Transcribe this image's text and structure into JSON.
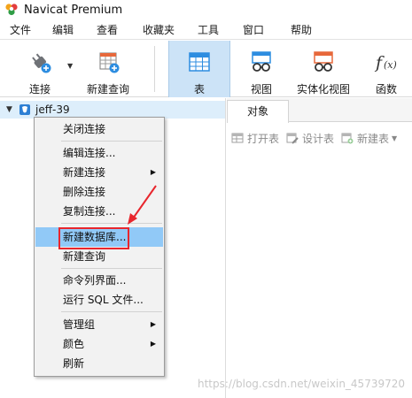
{
  "window": {
    "title": "Navicat Premium",
    "logo_icon": "navicat-logo-icon"
  },
  "menubar": {
    "items": [
      "文件",
      "编辑",
      "查看",
      "收藏夹",
      "工具",
      "窗口",
      "帮助"
    ]
  },
  "toolbar": {
    "buttons": [
      {
        "label": "连接",
        "icon": "plug-connect-icon"
      },
      {
        "label": "新建查询",
        "icon": "new-query-icon"
      },
      {
        "label": "表",
        "icon": "table-icon",
        "active": true
      },
      {
        "label": "视图",
        "icon": "view-glasses-icon"
      },
      {
        "label": "实体化视图",
        "icon": "materialized-view-icon"
      },
      {
        "label": "函数",
        "icon": "function-fx-icon"
      }
    ]
  },
  "navigator": {
    "connection": {
      "name": "jeff-39",
      "expanded": true,
      "icon": "mysql-connection-icon"
    }
  },
  "objects_tab": {
    "label": "对象"
  },
  "object_toolbar": {
    "open_table": "打开表",
    "design_table": "设计表",
    "new_table": "新建表"
  },
  "context_menu": {
    "items": [
      {
        "label": "关闭连接"
      },
      {
        "label": "编辑连接..."
      },
      {
        "label": "新建连接",
        "submenu": true
      },
      {
        "label": "删除连接"
      },
      {
        "label": "复制连接..."
      },
      {
        "label": "新建数据库...",
        "highlighted": true
      },
      {
        "label": "新建查询"
      },
      {
        "label": "命令列界面..."
      },
      {
        "label": "运行 SQL 文件..."
      },
      {
        "label": "管理组",
        "submenu": true
      },
      {
        "label": "颜色",
        "submenu": true
      },
      {
        "label": "刷新"
      }
    ],
    "highlight_color": "#91c9f7"
  },
  "annotation": {
    "color": "#e8262d"
  },
  "watermark": "https://blog.csdn.net/weixin_45739720"
}
